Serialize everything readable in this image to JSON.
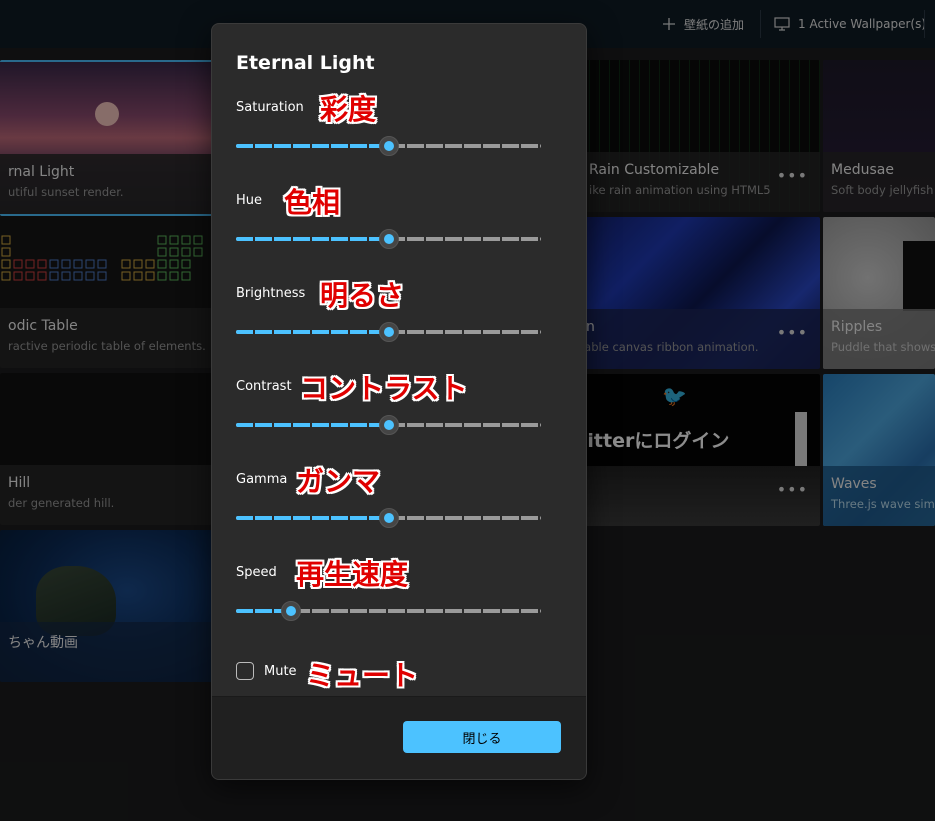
{
  "topbar": {
    "add_wallpaper_label": "壁紙の追加",
    "active_wallpapers_label": "1 Active Wallpaper(s)"
  },
  "tiles": [
    {
      "title": "rnal Light",
      "subtitle": "utiful sunset render."
    },
    {
      "title": "odic Table",
      "subtitle": "ractive periodic table of elements."
    },
    {
      "title": " Hill",
      "subtitle": "der generated hill."
    },
    {
      "title": "ちゃん動画",
      "subtitle": ""
    },
    {
      "title": "Rain Customizable",
      "subtitle": "ike rain animation using HTML5"
    },
    {
      "title": "n",
      "subtitle": "isable canvas ribbon animation."
    },
    {
      "title": "vitterにログイン",
      "subtitle": ""
    },
    {
      "title": "Medusae",
      "subtitle": "Soft body jellyfish sin"
    },
    {
      "title": "Ripples",
      "subtitle": "Puddle that shows w"
    },
    {
      "title": "Waves",
      "subtitle": "Three.js wave simula"
    }
  ],
  "more_label": "•••",
  "dialog": {
    "title": "Eternal Light",
    "sliders": [
      {
        "label": "Saturation",
        "note": "彩度",
        "value": 0.5
      },
      {
        "label": "Hue",
        "note": "色相",
        "value": 0.5
      },
      {
        "label": "Brightness",
        "note": "明るさ",
        "value": 0.5
      },
      {
        "label": "Contrast",
        "note": "コントラスト",
        "value": 0.5
      },
      {
        "label": "Gamma",
        "note": "ガンマ",
        "value": 0.5
      },
      {
        "label": "Speed",
        "note": "再生速度",
        "value": 0.18
      }
    ],
    "mute_label": "Mute",
    "mute_note": "ミュート",
    "close_label": "閉じる"
  },
  "colors": {
    "accent": "#4cc2ff",
    "annotation": "#e00000"
  }
}
